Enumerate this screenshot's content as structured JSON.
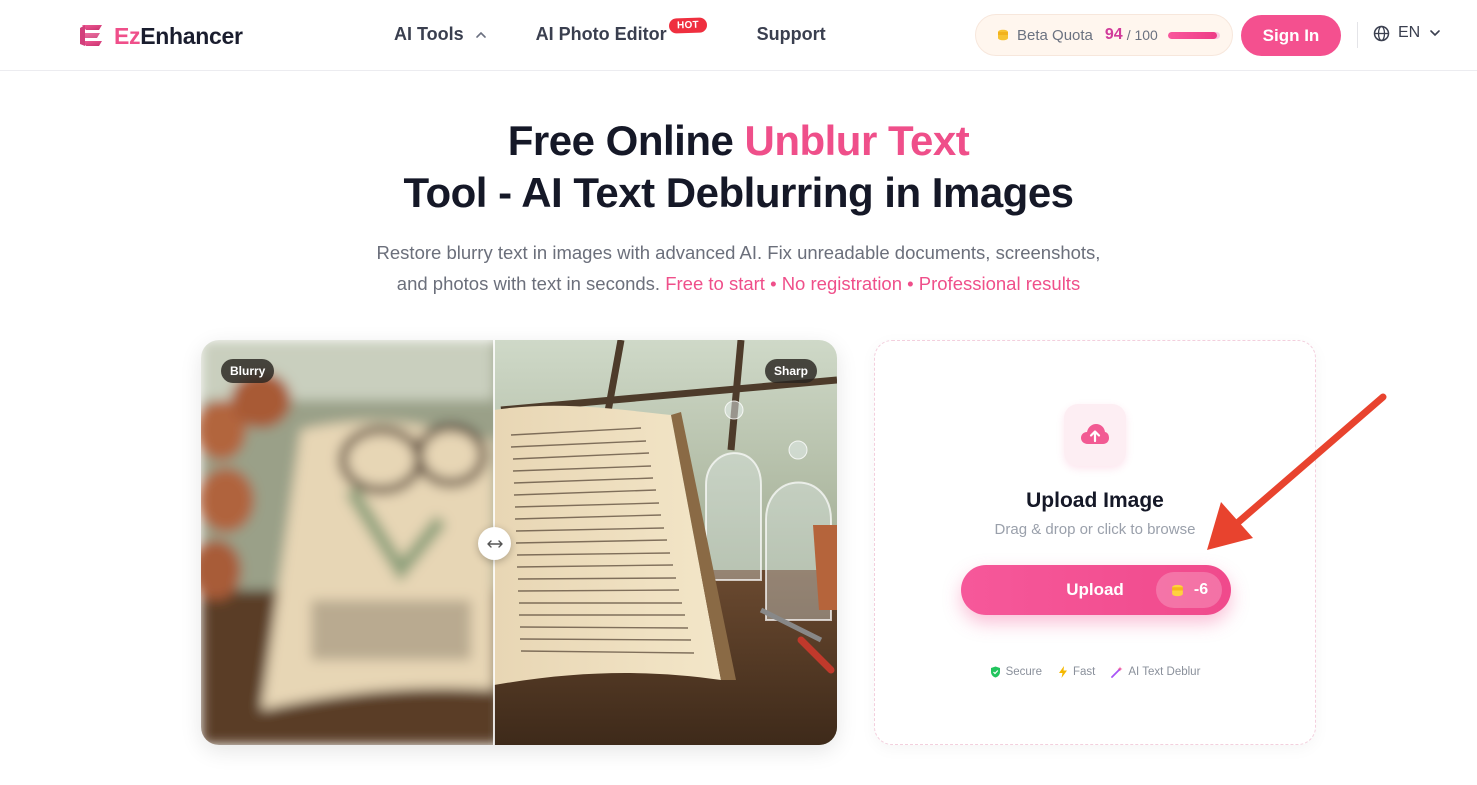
{
  "header": {
    "logo_ez": "Ez",
    "logo_rest": "Enhancer",
    "nav": [
      {
        "label": "AI Tools"
      },
      {
        "label": "AI Photo Editor",
        "badge": "HOT"
      },
      {
        "label": "Support"
      }
    ],
    "quota": {
      "label": "Beta Quota",
      "used": "94",
      "total": "/ 100",
      "fraction": 0.94
    },
    "sign_in": "Sign In",
    "language": "EN"
  },
  "hero": {
    "title_part1": "Free Online ",
    "title_accent": "Unblur Text",
    "title_part2": " Tool - AI Text Deblurring in Images",
    "subtitle_line1": "Restore blurry text in images with advanced AI. Fix unreadable documents, screenshots,",
    "subtitle_line2": "and photos with text in seconds. ",
    "subtitle_highlight": "Free to start • No registration • Professional results"
  },
  "compare": {
    "before_label": "Blurry",
    "after_label": "Sharp",
    "handle_icon": "arrows-horizontal-icon"
  },
  "upload": {
    "icon": "cloud-upload-icon",
    "title": "Upload Image",
    "hint": "Drag & drop or click to browse",
    "button_label": "Upload",
    "cost": "-6",
    "features": [
      {
        "icon": "shield-icon",
        "label": "Secure",
        "color": "#22c55e"
      },
      {
        "icon": "lightning-icon",
        "label": "Fast",
        "color": "#f5b800"
      },
      {
        "icon": "magic-wand-icon",
        "label": "AI Text Deblur",
        "color": "#a855f7"
      }
    ]
  },
  "colors": {
    "brand_pink": "#ef4f8a",
    "arrow_red": "#e8432e",
    "text_dark": "#151827"
  }
}
